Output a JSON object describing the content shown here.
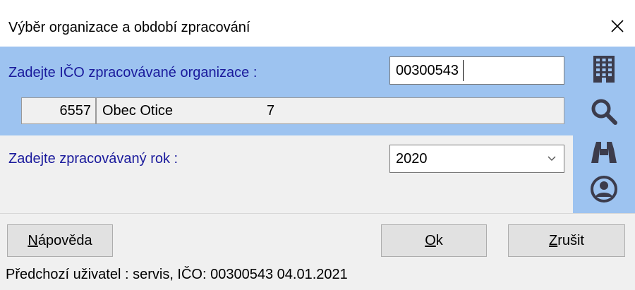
{
  "window": {
    "title": "Výběr organizace a období zpracování",
    "close_icon": "close-icon"
  },
  "organization": {
    "label": "Zadejte IČO zpracovávané organizace :",
    "ico_value": "00300543",
    "number": "6557",
    "name": "Obec Otice",
    "code": "7"
  },
  "year": {
    "label": "Zadejte zpracovávaný rok :",
    "selected": "2020"
  },
  "toolbar": {
    "icons": [
      "building-icon",
      "search-icon",
      "binoculars-icon",
      "user-icon"
    ]
  },
  "buttons": {
    "help_mnemonic": "N",
    "help_rest": "ápověda",
    "ok_mnemonic": "O",
    "ok_rest": "k",
    "cancel_mnemonic": "Z",
    "cancel_rest": "rušit"
  },
  "status": {
    "text": "Předchozí uživatel : servis, IČO: 00300543 04.01.2021"
  },
  "colors": {
    "panel_blue": "#9dc3f0",
    "label_blue": "#1a1a9c",
    "icon_dark": "#3c3c4c"
  }
}
